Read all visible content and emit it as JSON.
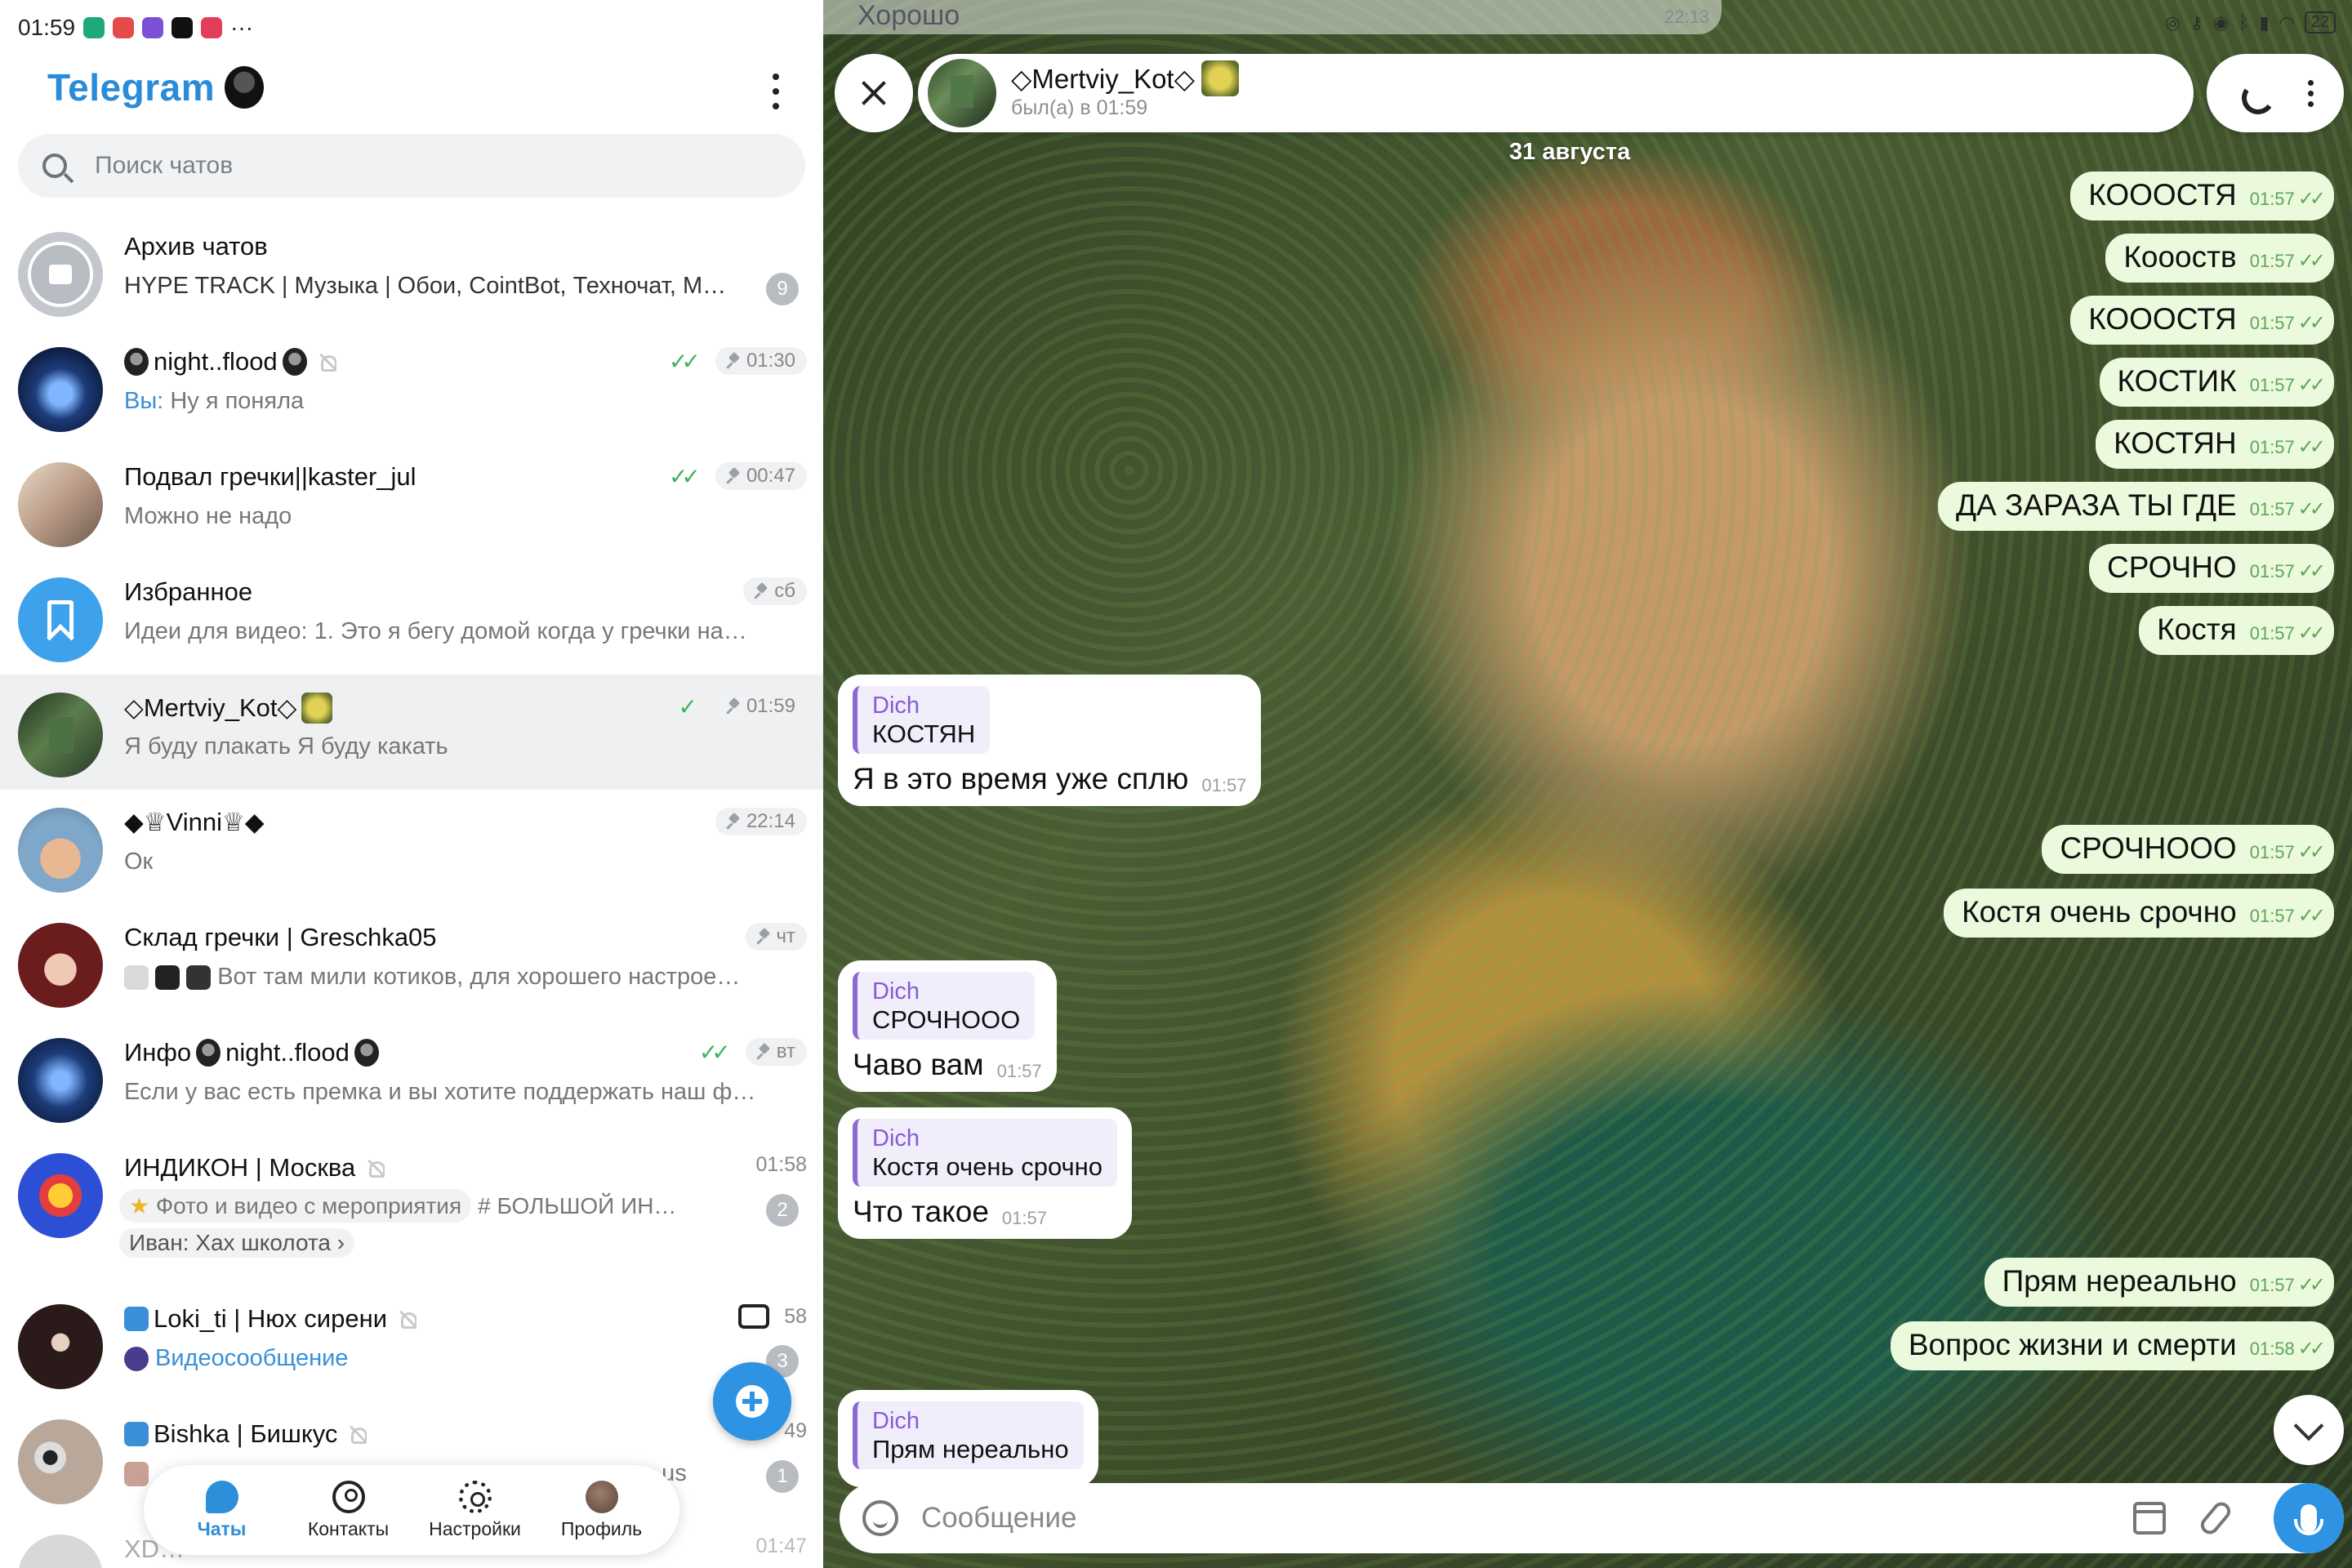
{
  "status_bar": {
    "time": "01:59",
    "more": "···",
    "battery": "22"
  },
  "app": {
    "title": "Telegram"
  },
  "search": {
    "placeholder": "Поиск чатов"
  },
  "chats": [
    {
      "title": "Архив чатов",
      "subtitle": "HYPE TRACK | Музыка | Обои, CointBot, Техночат, М…",
      "badge": "9"
    },
    {
      "title": "night..flood",
      "you_prefix": "Вы: ",
      "subtitle": "Ну я поняла",
      "time": "01:30"
    },
    {
      "title": "Подвал гречки||kaster_jul",
      "subtitle": "Можно не надо",
      "time": "00:47"
    },
    {
      "title": "Избранное",
      "subtitle": "Идеи для видео: 1. Это я бегу домой когда у гречки на…",
      "time": "сб"
    },
    {
      "title": "◇Mertviy_Kot◇",
      "subtitle": "Я буду плакать Я буду какать",
      "time": "01:59"
    },
    {
      "title": "◆♕Vinni♕◆",
      "subtitle": "Ок",
      "time": "22:14"
    },
    {
      "title": "Склад гречки | Greschka05",
      "subtitle": "Вот там мили котиков, для хорошего настрое…",
      "time": "чт"
    },
    {
      "title_prefix": "Инфо",
      "title": "night..flood",
      "subtitle": "Если у вас есть премка и вы хотите поддержать наш ф…",
      "time": "вт"
    },
    {
      "title": "ИНДИКОН | Москва",
      "time": "01:58",
      "tag1": "Фото и видео с мероприятия",
      "tag2": "# БОЛЬШОЙ ИН…",
      "reply": "Иван: Хах школота ›",
      "badge": "2"
    },
    {
      "title": "Loki_ti | Нюх сирени",
      "subtitle": "Видеосообщение",
      "time": "58",
      "badge": "3"
    },
    {
      "title": "Bishka | Бишкус",
      "subtitle": "us",
      "time": "49",
      "badge": "1"
    },
    {
      "title": "XD…",
      "time": "01:47"
    }
  ],
  "nav": {
    "chats": "Чаты",
    "contacts": "Контакты",
    "settings": "Настройки",
    "profile": "Профиль"
  },
  "conversation": {
    "ghost_text": "Хорошо",
    "ghost_time": "22:13",
    "contact_name": "◇Mertviy_Kot◇",
    "contact_status": "был(а) в 01:59",
    "date": "31 августа",
    "messages_out_top": [
      {
        "text": "КОООСТЯ",
        "time": "01:57"
      },
      {
        "text": "Коооств",
        "time": "01:57"
      },
      {
        "text": "КОООСТЯ",
        "time": "01:57"
      },
      {
        "text": "КОСТИК",
        "time": "01:57"
      },
      {
        "text": "КОСТЯН",
        "time": "01:57"
      },
      {
        "text": "ДА ЗАРАЗА ТЫ ГДЕ",
        "time": "01:57"
      },
      {
        "text": "СРОЧНО",
        "time": "01:57"
      },
      {
        "text": "Костя",
        "time": "01:57"
      }
    ],
    "msg_in_1": {
      "quote_name": "Dich",
      "quote_text": "КОСТЯН",
      "text": "Я в это время уже сплю",
      "time": "01:57"
    },
    "messages_out_mid": [
      {
        "text": "СРОЧНООО",
        "time": "01:57"
      },
      {
        "text": "Костя очень срочно",
        "time": "01:57"
      }
    ],
    "msg_in_2": {
      "quote_name": "Dich",
      "quote_text": "СРОЧНООО",
      "text": "Чаво вам",
      "time": "01:57"
    },
    "msg_in_3": {
      "quote_name": "Dich",
      "quote_text": "Костя очень срочно",
      "text": "Что такое",
      "time": "01:57"
    },
    "messages_out_bottom": [
      {
        "text": "Прям нереально",
        "time": "01:57"
      },
      {
        "text": "Вопрос жизни и смерти",
        "time": "01:58"
      }
    ],
    "msg_in_4": {
      "quote_name": "Dich",
      "quote_text": "Прям нереально"
    },
    "composer_placeholder": "Сообщение"
  },
  "colors": {
    "accent": "#2d93e2",
    "brand": "#2a8bd8",
    "outgoing_bubble": "#ebf9dc",
    "quote_name": "#8a59d6"
  }
}
